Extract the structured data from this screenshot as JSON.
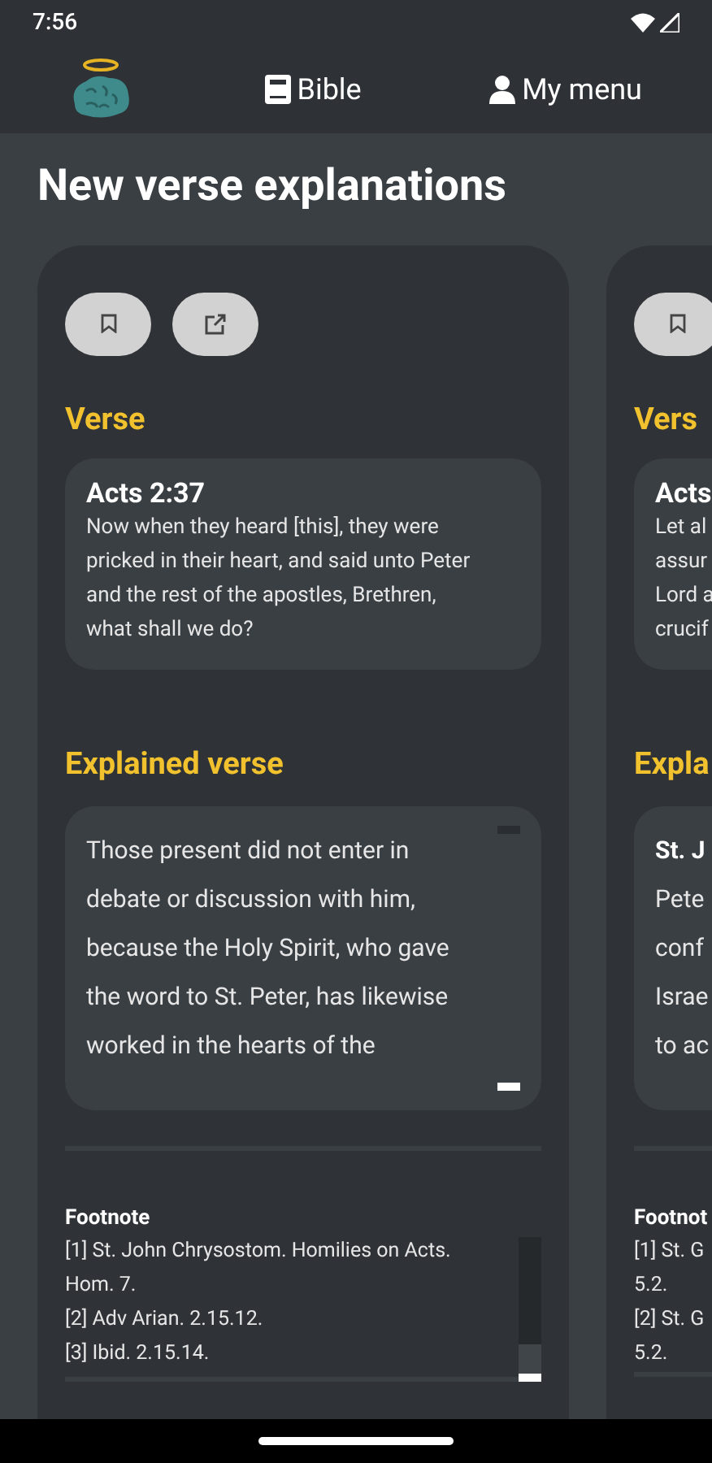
{
  "status_bar": {
    "time": "7:56"
  },
  "nav": {
    "items": [
      {
        "kind": "logo"
      },
      {
        "kind": "book",
        "label": "Bible"
      },
      {
        "kind": "person",
        "label": "My menu"
      }
    ]
  },
  "title": "New verse explanations",
  "cards": [
    {
      "buttons": [
        {
          "kind": "bookmark"
        },
        {
          "kind": "share"
        }
      ],
      "verse_heading": "Verse",
      "reference": "Acts 2:37",
      "verse_lines": [
        "Now when they heard [this], they were",
        "pricked in their heart, and said unto Peter",
        "and the rest of the apostles, Brethren,",
        "what shall we do?"
      ],
      "explained_heading": "Explained verse",
      "explanation_lines": [
        "Those present did not enter in",
        "debate or discussion with him,",
        "because the Holy Spirit, who gave",
        "the word to St. Peter, has likewise",
        "worked in the hearts of the"
      ],
      "footnote_heading": "Footnote",
      "footnote_lines": [
        "[1] St. John Chrysostom. Homilies on Acts.",
        "Hom. 7.",
        "[2] Adv Arian. 2.15.12.",
        "[3] Ibid. 2.15.14."
      ]
    },
    {
      "buttons": [
        {
          "kind": "bookmark"
        }
      ],
      "verse_heading": "Vers",
      "reference": "Acts",
      "verse_lines": [
        "Let al",
        "assur",
        "Lord a",
        "crucif"
      ],
      "explained_heading": "Expla",
      "explanation_title": "St. J",
      "explanation_lines": [
        "Pete",
        "conf",
        "Israe",
        "to ac"
      ],
      "footnote_heading": "Footnot",
      "footnote_lines": [
        "[1] St. G",
        "5.2.",
        "[2] St. G",
        "5.2."
      ]
    }
  ]
}
